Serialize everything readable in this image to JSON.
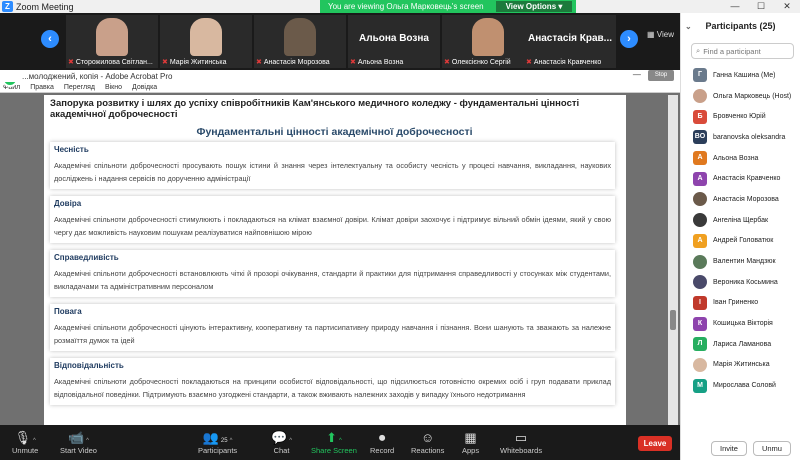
{
  "titlebar": {
    "app_title": "Zoom Meeting",
    "share_banner": "You are viewing Ольга Марковець's screen",
    "view_options": "View Options"
  },
  "gallery": {
    "view_label": "View",
    "tiles": [
      {
        "name": "Сторожилова Світлан...",
        "type": "video",
        "face_color": "#c9a08a"
      },
      {
        "name": "Марія Житинська",
        "type": "video",
        "face_color": "#d8b8a0"
      },
      {
        "name": "Анастасія Морозова",
        "type": "video",
        "face_color": "#6b5a4a"
      },
      {
        "name": "Альона Возна",
        "type": "name_only"
      },
      {
        "name": "Олексієнко Сергій",
        "type": "video",
        "face_color": "#c09070"
      },
      {
        "name": "Анастасія Крав...",
        "type": "name_only"
      },
      {
        "name": "Анастасія Кравченко",
        "type": "name_only"
      }
    ]
  },
  "acrobat": {
    "title": "...молоджений, копія - Adobe Acrobat Pro",
    "stop_share": "Stop Sh...",
    "menu": [
      "Файл",
      "Правка",
      "Перегляд",
      "Вікно",
      "Довідка"
    ]
  },
  "document": {
    "title": "Запорука розвитку і шлях до успіху співробітників Кам'янського медичного коледжу - фундаментальні цінності академічної доброчесності",
    "subtitle": "Фундаментальні цінності академічної доброчесності",
    "sections": [
      {
        "heading": "Чесність",
        "text": "Академічні спільноти доброчесності просувають пошук істини й знання через інтелектуальну та особисту чесність у процесі навчання, викладання, наукових досліджень і надання сервісів по дорученню адміністрації"
      },
      {
        "heading": "Довіра",
        "text": "Академічні спільноти доброчесності стимулюють і покладаються на клімат взаємної довіри. Клімат довіри заохочує і підтримує вільний обмін ідеями, який у свою чергу дає можливість науковим пошукам реалізуватися найповнішою мірою"
      },
      {
        "heading": "Справедливість",
        "text": "Академічні спільноти доброчесності встановлюють чіткі й прозорі очікування, стандарти й практики для підтримання справедливості у стосунках між студентами, викладачами та адміністративним персоналом"
      },
      {
        "heading": "Повага",
        "text": "Академічні спільноти доброчесності цінують інтерактивну, кооперативну та партисипативну природу навчання і пізнання. Вони шанують та зважають за належне розмаїття думок та ідей"
      },
      {
        "heading": "Відповідальність",
        "text": "Академічні спільноти доброчесності покладаються на принципи особистої відповідальності, що підсилюється готовністю окремих осіб і груп подавати приклад відповідальної поведінки. Підтримують взаємно узгоджені стандарти, а також вживають належних заходів у випадку їхнього недотримання"
      }
    ]
  },
  "participants": {
    "title": "Participants (25)",
    "search_placeholder": "Find a participant",
    "list": [
      {
        "initials": "Г",
        "name": "Ганна Кашина (Me)",
        "color": "#6a7a8c",
        "photo": false
      },
      {
        "initials": "",
        "name": "Ольга Марковець (Host)",
        "color": "#c9a08a",
        "photo": true
      },
      {
        "initials": "Б",
        "name": "Бровченко Юрій",
        "color": "#d94b3a",
        "photo": false
      },
      {
        "initials": "BO",
        "name": "baranovska oleksandra",
        "color": "#2c3e5a",
        "photo": false
      },
      {
        "initials": "А",
        "name": "Альона Возна",
        "color": "#e0791f",
        "photo": false
      },
      {
        "initials": "А",
        "name": "Анастасія Кравченко",
        "color": "#8e44ad",
        "photo": false
      },
      {
        "initials": "",
        "name": "Анастасія Морозова",
        "color": "#6b5a4a",
        "photo": true
      },
      {
        "initials": "",
        "name": "Ангеліна Щербак",
        "color": "#3a3a3a",
        "photo": true
      },
      {
        "initials": "А",
        "name": "Андрей Головатюк",
        "color": "#f0a020",
        "photo": false
      },
      {
        "initials": "",
        "name": "Валентин Мандзюк",
        "color": "#5a7a5a",
        "photo": true
      },
      {
        "initials": "",
        "name": "Вероника Косьмина",
        "color": "#4a4a6a",
        "photo": true
      },
      {
        "initials": "І",
        "name": "Іван Гриненко",
        "color": "#c0392b",
        "photo": false
      },
      {
        "initials": "К",
        "name": "Кошицька Вікторія",
        "color": "#8e44ad",
        "photo": false
      },
      {
        "initials": "Л",
        "name": "Лариса Ламанова",
        "color": "#27ae60",
        "photo": false
      },
      {
        "initials": "",
        "name": "Марія Житинська",
        "color": "#d8b8a0",
        "photo": true
      },
      {
        "initials": "М",
        "name": "Мирослава Соловй",
        "color": "#16a085",
        "photo": false
      }
    ],
    "invite": "Invite",
    "unmute": "Unmu"
  },
  "toolbar": {
    "unmute": "Unmute",
    "start_video": "Start Video",
    "participants": "Participants",
    "participants_count": "25",
    "chat": "Chat",
    "share_screen": "Share Screen",
    "record": "Record",
    "reactions": "Reactions",
    "apps": "Apps",
    "whiteboards": "Whiteboards",
    "leave": "Leave"
  }
}
